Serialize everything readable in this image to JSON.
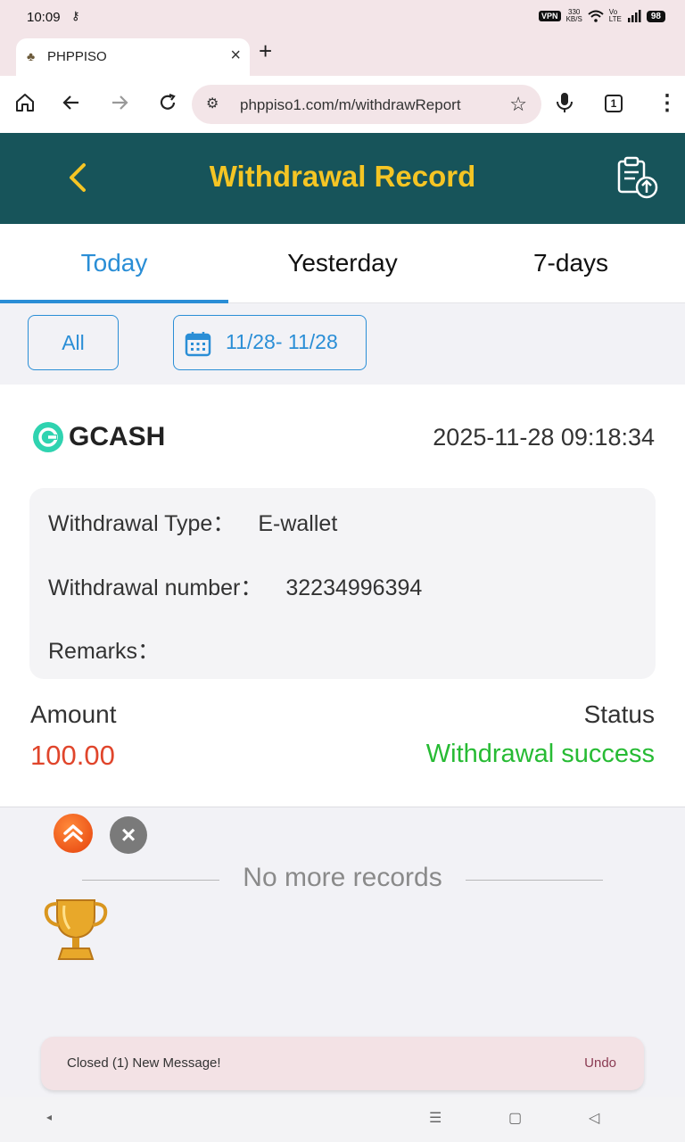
{
  "status_bar": {
    "time": "10:09",
    "vpn": "VPN",
    "speed_value": "330",
    "speed_unit": "KB/S",
    "battery": "98"
  },
  "browser": {
    "tab_title": "PHPPISO",
    "url": "phppiso1.com/m/withdrawReport",
    "tab_count": "1"
  },
  "header": {
    "title": "Withdrawal Record",
    "accent_color": "#f5c524",
    "background_color": "#17545a"
  },
  "period_tabs": [
    {
      "label": "Today",
      "active": true
    },
    {
      "label": "Yesterday",
      "active": false
    },
    {
      "label": "7-days",
      "active": false
    }
  ],
  "filters": {
    "type_label": "All",
    "date_range": "11/28- 11/28"
  },
  "records": [
    {
      "method": "GCASH",
      "datetime": "2025-11-28 09:18:34",
      "type_label": "Withdrawal Type：",
      "type_value": "E-wallet",
      "number_label": "Withdrawal number：",
      "number_value": "32234996394",
      "remarks_label": "Remarks：",
      "remarks_value": "",
      "amount_label": "Amount",
      "amount_value": "100.00",
      "status_label": "Status",
      "status_value": "Withdrawal success",
      "amount_color": "#e0452b",
      "status_color": "#27bb34"
    }
  ],
  "list_footer": "No more records",
  "snackbar": {
    "message": "Closed (1) New Message!",
    "action": "Undo"
  }
}
